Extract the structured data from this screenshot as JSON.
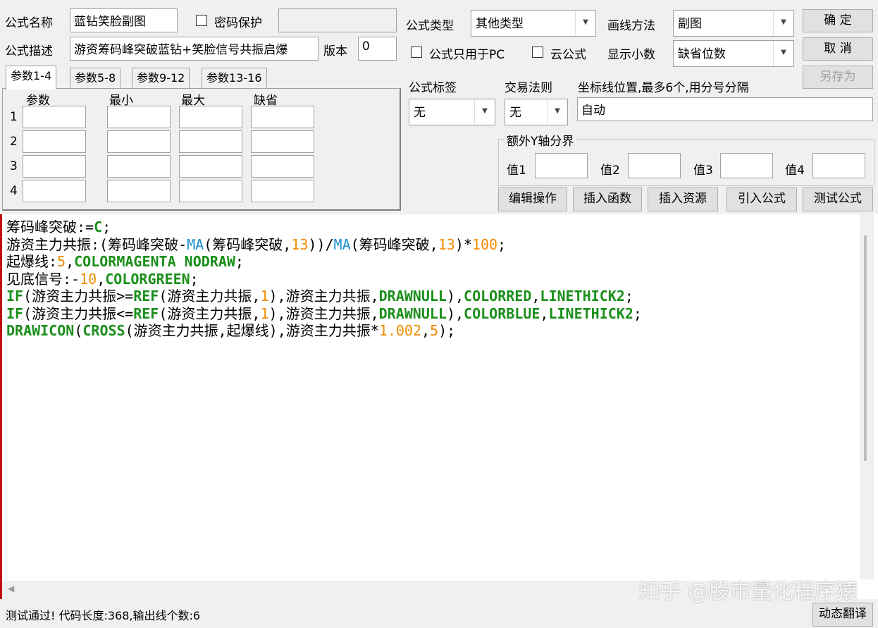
{
  "header": {
    "name_label": "公式名称",
    "name_value": "蓝钻笑脸副图",
    "password_label": "密码保护",
    "desc_label": "公式描述",
    "desc_value": "游资筹码峰突破蓝钻+笑脸信号共振启爆",
    "version_label": "版本",
    "version_value": "0",
    "type_label": "公式类型",
    "type_value": "其他类型",
    "draw_label": "画线方法",
    "draw_value": "副图",
    "pc_only_label": "公式只用于PC",
    "cloud_label": "云公式",
    "decimals_label": "显示小数",
    "decimals_value": "缺省位数"
  },
  "buttons": {
    "ok": "确  定",
    "cancel": "取  消",
    "save_as": "另存为",
    "edit": "编辑操作",
    "insert_fn": "插入函数",
    "insert_res": "插入资源",
    "import": "引入公式",
    "test": "测试公式",
    "translate": "动态翻译"
  },
  "tabs": [
    "参数1-4",
    "参数5-8",
    "参数9-12",
    "参数13-16"
  ],
  "params": {
    "headers": [
      "参数",
      "最小",
      "最大",
      "缺省"
    ],
    "rows": [
      "1",
      "2",
      "3",
      "4"
    ]
  },
  "tag_label": "公式标签",
  "tag_value": "无",
  "rule_label": "交易法则",
  "rule_value": "无",
  "axis_label": "坐标线位置,最多6个,用分号分隔",
  "axis_value": "自动",
  "extra_y": {
    "title": "额外Y轴分界",
    "labels": [
      "值1",
      "值2",
      "值3",
      "值4"
    ]
  },
  "code": [
    [
      [
        "t",
        "筹码峰突破"
      ],
      [
        "t",
        ":="
      ],
      [
        "f",
        "C"
      ],
      [
        "t",
        ";"
      ]
    ],
    [
      [
        "t",
        "游资主力共振:(筹码峰突破-"
      ],
      [
        "m",
        "MA"
      ],
      [
        "t",
        "(筹码峰突破,"
      ],
      [
        "n",
        "13"
      ],
      [
        "t",
        "))/"
      ],
      [
        "m",
        "MA"
      ],
      [
        "t",
        "(筹码峰突破,"
      ],
      [
        "n",
        "13"
      ],
      [
        "t",
        ")*"
      ],
      [
        "n",
        "100"
      ],
      [
        "t",
        ";"
      ]
    ],
    [
      [
        "t",
        "起爆线:"
      ],
      [
        "n",
        "5"
      ],
      [
        "t",
        ","
      ],
      [
        "f",
        "COLORMAGENTA NODRAW"
      ],
      [
        "t",
        ";"
      ]
    ],
    [
      [
        "t",
        "见底信号:-"
      ],
      [
        "n",
        "10"
      ],
      [
        "t",
        ","
      ],
      [
        "f",
        "COLORGREEN"
      ],
      [
        "t",
        ";"
      ]
    ],
    [
      [
        "f",
        "IF"
      ],
      [
        "t",
        "(游资主力共振>="
      ],
      [
        "f",
        "REF"
      ],
      [
        "t",
        "(游资主力共振,"
      ],
      [
        "n",
        "1"
      ],
      [
        "t",
        "),游资主力共振,"
      ],
      [
        "f",
        "DRAWNULL"
      ],
      [
        "t",
        "),"
      ],
      [
        "f",
        "COLORRED"
      ],
      [
        "t",
        ","
      ],
      [
        "f",
        "LINETHICK2"
      ],
      [
        "t",
        ";"
      ]
    ],
    [
      [
        "f",
        "IF"
      ],
      [
        "t",
        "(游资主力共振<="
      ],
      [
        "f",
        "REF"
      ],
      [
        "t",
        "(游资主力共振,"
      ],
      [
        "n",
        "1"
      ],
      [
        "t",
        "),游资主力共振,"
      ],
      [
        "f",
        "DRAWNULL"
      ],
      [
        "t",
        "),"
      ],
      [
        "f",
        "COLORBLUE"
      ],
      [
        "t",
        ","
      ],
      [
        "f",
        "LINETHICK2"
      ],
      [
        "t",
        ";"
      ]
    ],
    [
      [
        "f",
        "DRAWICON"
      ],
      [
        "t",
        "("
      ],
      [
        "f",
        "CROSS"
      ],
      [
        "t",
        "(游资主力共振,起爆线),游资主力共振*"
      ],
      [
        "n",
        "1.002"
      ],
      [
        "t",
        ","
      ],
      [
        "n",
        "5"
      ],
      [
        "t",
        ");"
      ]
    ]
  ],
  "status": "测试通过! 代码长度:368,输出线个数:6",
  "watermark": "知乎 @股市量化程序猿"
}
